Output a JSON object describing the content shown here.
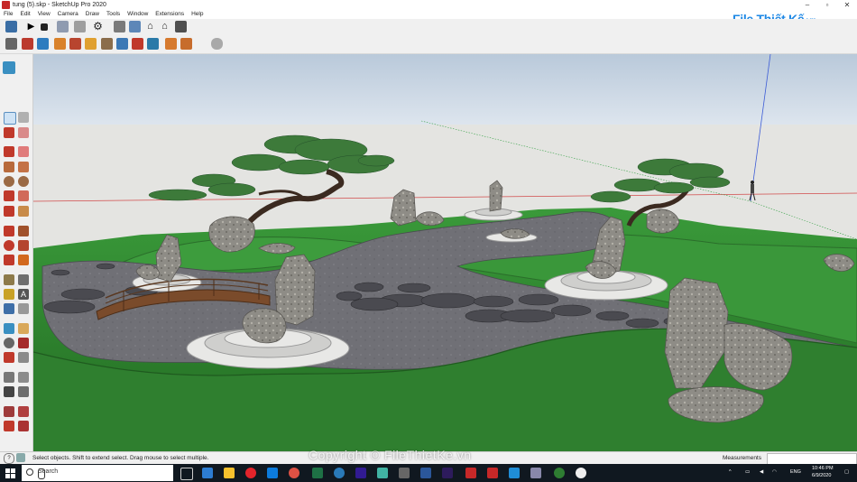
{
  "window": {
    "title": "tung (5).skp - SketchUp Pro 2020"
  },
  "menu": [
    "File",
    "Edit",
    "View",
    "Camera",
    "Draw",
    "Tools",
    "Window",
    "Extensions",
    "Help"
  ],
  "brand": {
    "text": "File Thiết Kế",
    "suffix": ".vn"
  },
  "status": {
    "message": "Select objects. Shift to extend select. Drag mouse to select multiple.",
    "measurements_label": "Measurements"
  },
  "watermark": "Copyright © FileThietKe.vn",
  "taskbar": {
    "search_placeholder": "Search",
    "language": "ENG",
    "time": "10:46 PM",
    "date": "6/9/2020"
  },
  "colors": {
    "sky": "#c7d4e2",
    "ground": "#e6e6e3",
    "grass": "#2f8a2f",
    "path": "#6d6d72",
    "brand": "#1e88e5"
  }
}
